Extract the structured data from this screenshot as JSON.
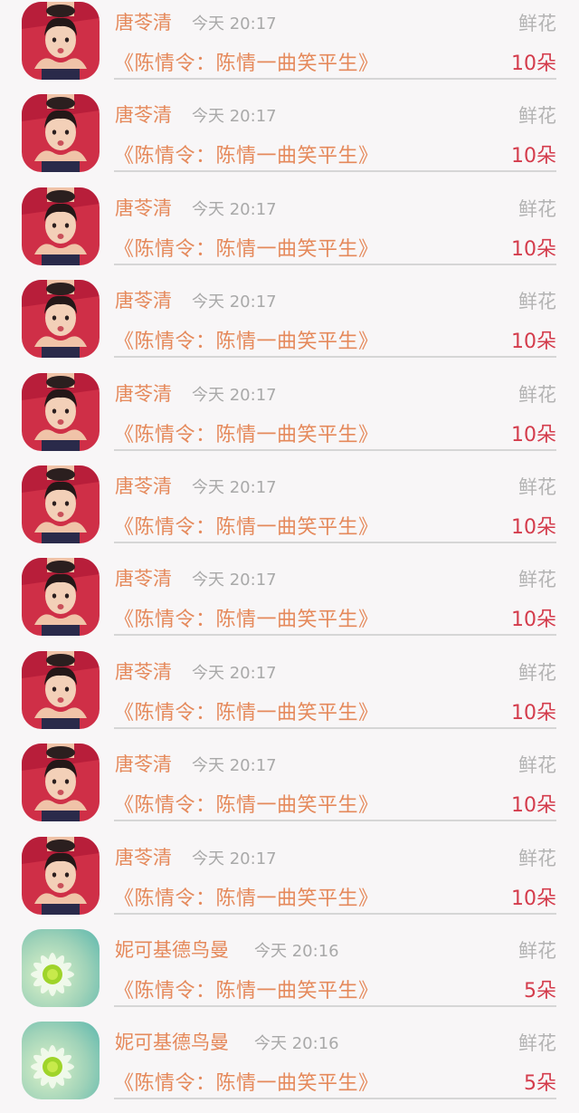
{
  "gift_records": [
    {
      "username": "唐苓清",
      "time": "今天 20:17",
      "gift_type": "鲜花",
      "work_title": "《陈情令：陈情一曲笑平生》",
      "amount": "10朵",
      "avatar": "portrait-photo"
    },
    {
      "username": "唐苓清",
      "time": "今天 20:17",
      "gift_type": "鲜花",
      "work_title": "《陈情令：陈情一曲笑平生》",
      "amount": "10朵",
      "avatar": "portrait-photo"
    },
    {
      "username": "唐苓清",
      "time": "今天 20:17",
      "gift_type": "鲜花",
      "work_title": "《陈情令：陈情一曲笑平生》",
      "amount": "10朵",
      "avatar": "portrait-photo"
    },
    {
      "username": "唐苓清",
      "time": "今天 20:17",
      "gift_type": "鲜花",
      "work_title": "《陈情令：陈情一曲笑平生》",
      "amount": "10朵",
      "avatar": "portrait-photo"
    },
    {
      "username": "唐苓清",
      "time": "今天 20:17",
      "gift_type": "鲜花",
      "work_title": "《陈情令：陈情一曲笑平生》",
      "amount": "10朵",
      "avatar": "portrait-photo"
    },
    {
      "username": "唐苓清",
      "time": "今天 20:17",
      "gift_type": "鲜花",
      "work_title": "《陈情令：陈情一曲笑平生》",
      "amount": "10朵",
      "avatar": "portrait-photo"
    },
    {
      "username": "唐苓清",
      "time": "今天 20:17",
      "gift_type": "鲜花",
      "work_title": "《陈情令：陈情一曲笑平生》",
      "amount": "10朵",
      "avatar": "portrait-photo"
    },
    {
      "username": "唐苓清",
      "time": "今天 20:17",
      "gift_type": "鲜花",
      "work_title": "《陈情令：陈情一曲笑平生》",
      "amount": "10朵",
      "avatar": "portrait-photo"
    },
    {
      "username": "唐苓清",
      "time": "今天 20:17",
      "gift_type": "鲜花",
      "work_title": "《陈情令：陈情一曲笑平生》",
      "amount": "10朵",
      "avatar": "portrait-photo"
    },
    {
      "username": "唐苓清",
      "time": "今天 20:17",
      "gift_type": "鲜花",
      "work_title": "《陈情令：陈情一曲笑平生》",
      "amount": "10朵",
      "avatar": "portrait-photo"
    },
    {
      "username": "妮可基德鸟曼",
      "time": "今天 20:16",
      "gift_type": "鲜花",
      "work_title": "《陈情令：陈情一曲笑平生》",
      "amount": "5朵",
      "avatar": "flower-photo"
    },
    {
      "username": "妮可基德鸟曼",
      "time": "今天 20:16",
      "gift_type": "鲜花",
      "work_title": "《陈情令：陈情一曲笑平生》",
      "amount": "5朵",
      "avatar": "flower-photo"
    }
  ],
  "colors": {
    "background": "#f8f6f7",
    "username": "#e5895b",
    "work_title": "#e5895b",
    "amount": "#d43c4c",
    "time": "#a9a9a9",
    "gift_type": "#b3b3b3",
    "divider": "#d6d6d6"
  }
}
